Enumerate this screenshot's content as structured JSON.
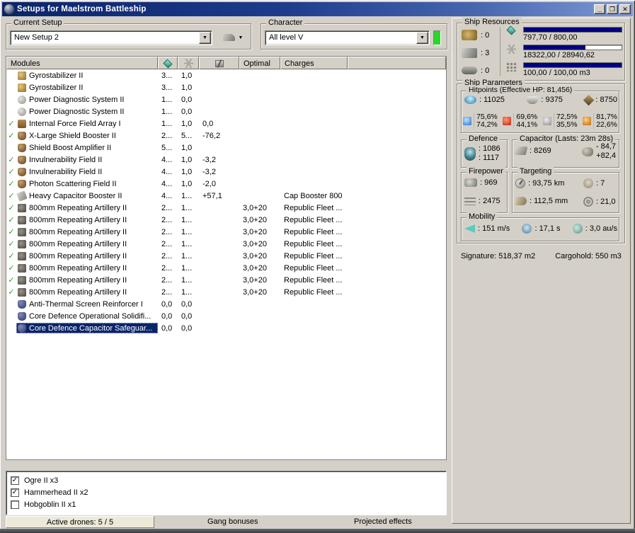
{
  "colors": {
    "titlebar_start": "#0a246a",
    "titlebar_end": "#7e99d6",
    "selection": "#0a246a",
    "bar_fill": "#000080",
    "active_check_green": "#2e9e2e",
    "character_status_green": "#2ed42e",
    "window_bg": "#d4d0c8"
  },
  "window": {
    "title": "Setups for Maelstrom Battleship",
    "minimize": "_",
    "maximize": "❐",
    "close": "✕"
  },
  "setup_group": {
    "label": "Current Setup",
    "value": "New Setup 2"
  },
  "character_group": {
    "label": "Character",
    "value": "All level V"
  },
  "modules_table": {
    "header": {
      "modules": "Modules",
      "optimal": "Optimal",
      "charges": "Charges"
    },
    "rows": [
      {
        "active": false,
        "selected": false,
        "icon": "gyro",
        "name": "Gyrostabilizer II",
        "cpu": "3...",
        "pg": "1,0",
        "cap": "",
        "optimal": "",
        "charges": ""
      },
      {
        "active": false,
        "selected": false,
        "icon": "gyro",
        "name": "Gyrostabilizer II",
        "cpu": "3...",
        "pg": "1,0",
        "cap": "",
        "optimal": "",
        "charges": ""
      },
      {
        "active": false,
        "selected": false,
        "icon": "pds",
        "name": "Power Diagnostic System II",
        "cpu": "1...",
        "pg": "0,0",
        "cap": "",
        "optimal": "",
        "charges": ""
      },
      {
        "active": false,
        "selected": false,
        "icon": "pds",
        "name": "Power Diagnostic System II",
        "cpu": "1...",
        "pg": "0,0",
        "cap": "",
        "optimal": "",
        "charges": ""
      },
      {
        "active": true,
        "selected": false,
        "icon": "iffa",
        "name": "Internal Force Field Array I",
        "cpu": "1...",
        "pg": "1,0",
        "cap": "0,0",
        "optimal": "",
        "charges": ""
      },
      {
        "active": true,
        "selected": false,
        "icon": "shield",
        "name": "X-Large Shield Booster II",
        "cpu": "2...",
        "pg": "5...",
        "cap": "-76,2",
        "optimal": "",
        "charges": ""
      },
      {
        "active": false,
        "selected": false,
        "icon": "shield",
        "name": "Shield Boost Amplifier II",
        "cpu": "5...",
        "pg": "1,0",
        "cap": "",
        "optimal": "",
        "charges": ""
      },
      {
        "active": true,
        "selected": false,
        "icon": "shield",
        "name": "Invulnerability Field II",
        "cpu": "4...",
        "pg": "1,0",
        "cap": "-3,2",
        "optimal": "",
        "charges": ""
      },
      {
        "active": true,
        "selected": false,
        "icon": "shield",
        "name": "Invulnerability Field II",
        "cpu": "4...",
        "pg": "1,0",
        "cap": "-3,2",
        "optimal": "",
        "charges": ""
      },
      {
        "active": true,
        "selected": false,
        "icon": "shield",
        "name": "Photon Scattering Field II",
        "cpu": "4...",
        "pg": "1,0",
        "cap": "-2,0",
        "optimal": "",
        "charges": ""
      },
      {
        "active": true,
        "selected": false,
        "icon": "capb",
        "name": "Heavy Capacitor Booster II",
        "cpu": "4...",
        "pg": "1...",
        "cap": "+57,1",
        "optimal": "",
        "charges": "Cap Booster 800"
      },
      {
        "active": true,
        "selected": false,
        "icon": "arty",
        "name": "800mm Repeating Artillery II",
        "cpu": "2...",
        "pg": "1...",
        "cap": "",
        "optimal": "3,0+20",
        "charges": "Republic Fleet ..."
      },
      {
        "active": true,
        "selected": false,
        "icon": "arty",
        "name": "800mm Repeating Artillery II",
        "cpu": "2...",
        "pg": "1...",
        "cap": "",
        "optimal": "3,0+20",
        "charges": "Republic Fleet ..."
      },
      {
        "active": true,
        "selected": false,
        "icon": "arty",
        "name": "800mm Repeating Artillery II",
        "cpu": "2...",
        "pg": "1...",
        "cap": "",
        "optimal": "3,0+20",
        "charges": "Republic Fleet ..."
      },
      {
        "active": true,
        "selected": false,
        "icon": "arty",
        "name": "800mm Repeating Artillery II",
        "cpu": "2...",
        "pg": "1...",
        "cap": "",
        "optimal": "3,0+20",
        "charges": "Republic Fleet ..."
      },
      {
        "active": true,
        "selected": false,
        "icon": "arty",
        "name": "800mm Repeating Artillery II",
        "cpu": "2...",
        "pg": "1...",
        "cap": "",
        "optimal": "3,0+20",
        "charges": "Republic Fleet ..."
      },
      {
        "active": true,
        "selected": false,
        "icon": "arty",
        "name": "800mm Repeating Artillery II",
        "cpu": "2...",
        "pg": "1...",
        "cap": "",
        "optimal": "3,0+20",
        "charges": "Republic Fleet ..."
      },
      {
        "active": true,
        "selected": false,
        "icon": "arty",
        "name": "800mm Repeating Artillery II",
        "cpu": "2...",
        "pg": "1...",
        "cap": "",
        "optimal": "3,0+20",
        "charges": "Republic Fleet ..."
      },
      {
        "active": true,
        "selected": false,
        "icon": "arty",
        "name": "800mm Repeating Artillery II",
        "cpu": "2...",
        "pg": "1...",
        "cap": "",
        "optimal": "3,0+20",
        "charges": "Republic Fleet ..."
      },
      {
        "active": false,
        "selected": false,
        "icon": "rig",
        "name": "Anti-Thermal Screen Reinforcer I",
        "cpu": "0,0",
        "pg": "0,0",
        "cap": "",
        "optimal": "",
        "charges": ""
      },
      {
        "active": false,
        "selected": false,
        "icon": "rig",
        "name": "Core Defence Operational Solidifi...",
        "cpu": "0,0",
        "pg": "0,0",
        "cap": "",
        "optimal": "",
        "charges": ""
      },
      {
        "active": false,
        "selected": true,
        "icon": "rig",
        "name": "Core Defence Capacitor Safeguar...",
        "cpu": "0,0",
        "pg": "0,0",
        "cap": "",
        "optimal": "",
        "charges": ""
      }
    ]
  },
  "drones": {
    "items": [
      {
        "checked": true,
        "label": "Ogre II x3"
      },
      {
        "checked": true,
        "label": "Hammerhead II x2"
      },
      {
        "checked": false,
        "label": "Hobgoblin II x1"
      }
    ]
  },
  "statusbar": {
    "active_drones": "Active drones: 5 / 5",
    "gang_bonuses": "Gang bonuses",
    "projected_effects": "Projected effects"
  },
  "ship_resources": {
    "label": "Ship Resources",
    "slots": [
      {
        "icon": "turret-hardpoints-icon",
        "value": ": 0"
      },
      {
        "icon": "launcher-hardpoints-icon",
        "value": ": 3"
      },
      {
        "icon": "rig-slots-icon",
        "value": ": 0"
      }
    ],
    "bars": [
      {
        "icon": "cpu-icon",
        "value": "797,70 / 800,00",
        "pct": 99.7
      },
      {
        "icon": "powergrid-icon",
        "value": "18322,00 / 28940,62",
        "pct": 63.3
      },
      {
        "icon": "dronebay-icon",
        "value": "100,00 / 100,00 m3",
        "pct": 100
      }
    ]
  },
  "ship_parameters": {
    "label": "Ship Parameters",
    "hitpoints": {
      "label": "Hitpoints (Effective HP: 81,456)",
      "shield": ": 11025",
      "armor": ": 9375",
      "structure": ": 8750",
      "resists": [
        {
          "icon": "em-resist-icon",
          "shield": "75,6%",
          "armor": "74,2%"
        },
        {
          "icon": "thermal-resist-icon",
          "shield": "69,6%",
          "armor": "44,1%"
        },
        {
          "icon": "kinetic-resist-icon",
          "shield": "72,5%",
          "armor": "35,5%"
        },
        {
          "icon": "explosive-resist-icon",
          "shield": "81,7%",
          "armor": "22,6%"
        }
      ]
    },
    "defence": {
      "label": "Defence",
      "tank_sustained": ": 1086",
      "tank_burst": ": 1117"
    },
    "capacitor": {
      "label": "Capacitor (Lasts: 23m 28s)",
      "amount": ": 8269",
      "drain": "- 84,7",
      "recharge": "+82,4"
    },
    "firepower": {
      "label": "Firepower",
      "dps": ": 969",
      "volley": ": 2475"
    },
    "targeting": {
      "label": "Targeting",
      "range": ": 93,75 km",
      "max_targets": ": 7",
      "scan_resolution": ": 112,5 mm",
      "sensor_strength": ": 21,0"
    },
    "mobility": {
      "label": "Mobility",
      "speed": ": 151 m/s",
      "align_time": ": 17,1 s",
      "warp_speed": ": 3,0 au/s"
    },
    "signature": "Signature: 518,37 m2",
    "cargohold": "Cargohold: 550 m3"
  }
}
